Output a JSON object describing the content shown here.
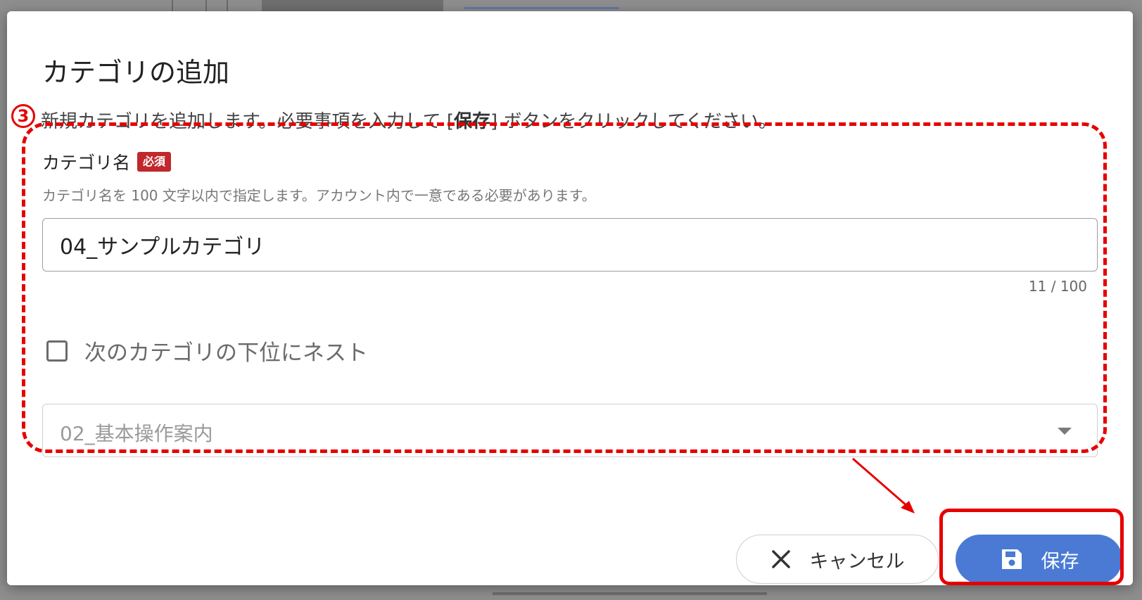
{
  "dialog": {
    "title": "カテゴリの追加",
    "step_number": "3",
    "description_before": "新規カテゴリを追加します。必要事項を入力して [",
    "description_bold": "保存",
    "description_after": "] ボタンをクリックしてください。"
  },
  "category_name": {
    "label": "カテゴリ名",
    "required_badge": "必須",
    "hint": "カテゴリ名を 100 文字以内で指定します。アカウント内で一意である必要があります。",
    "value": "04_サンプルカテゴリ",
    "counter": "11 / 100"
  },
  "nest": {
    "checkbox_label": "次のカテゴリの下位にネスト",
    "checked": false,
    "parent_select_value": "02_基本操作案内"
  },
  "actions": {
    "cancel_label": "キャンセル",
    "save_label": "保存"
  },
  "colors": {
    "primary": "#4a7ad4",
    "annotation": "#e60000",
    "required": "#c0282b"
  }
}
